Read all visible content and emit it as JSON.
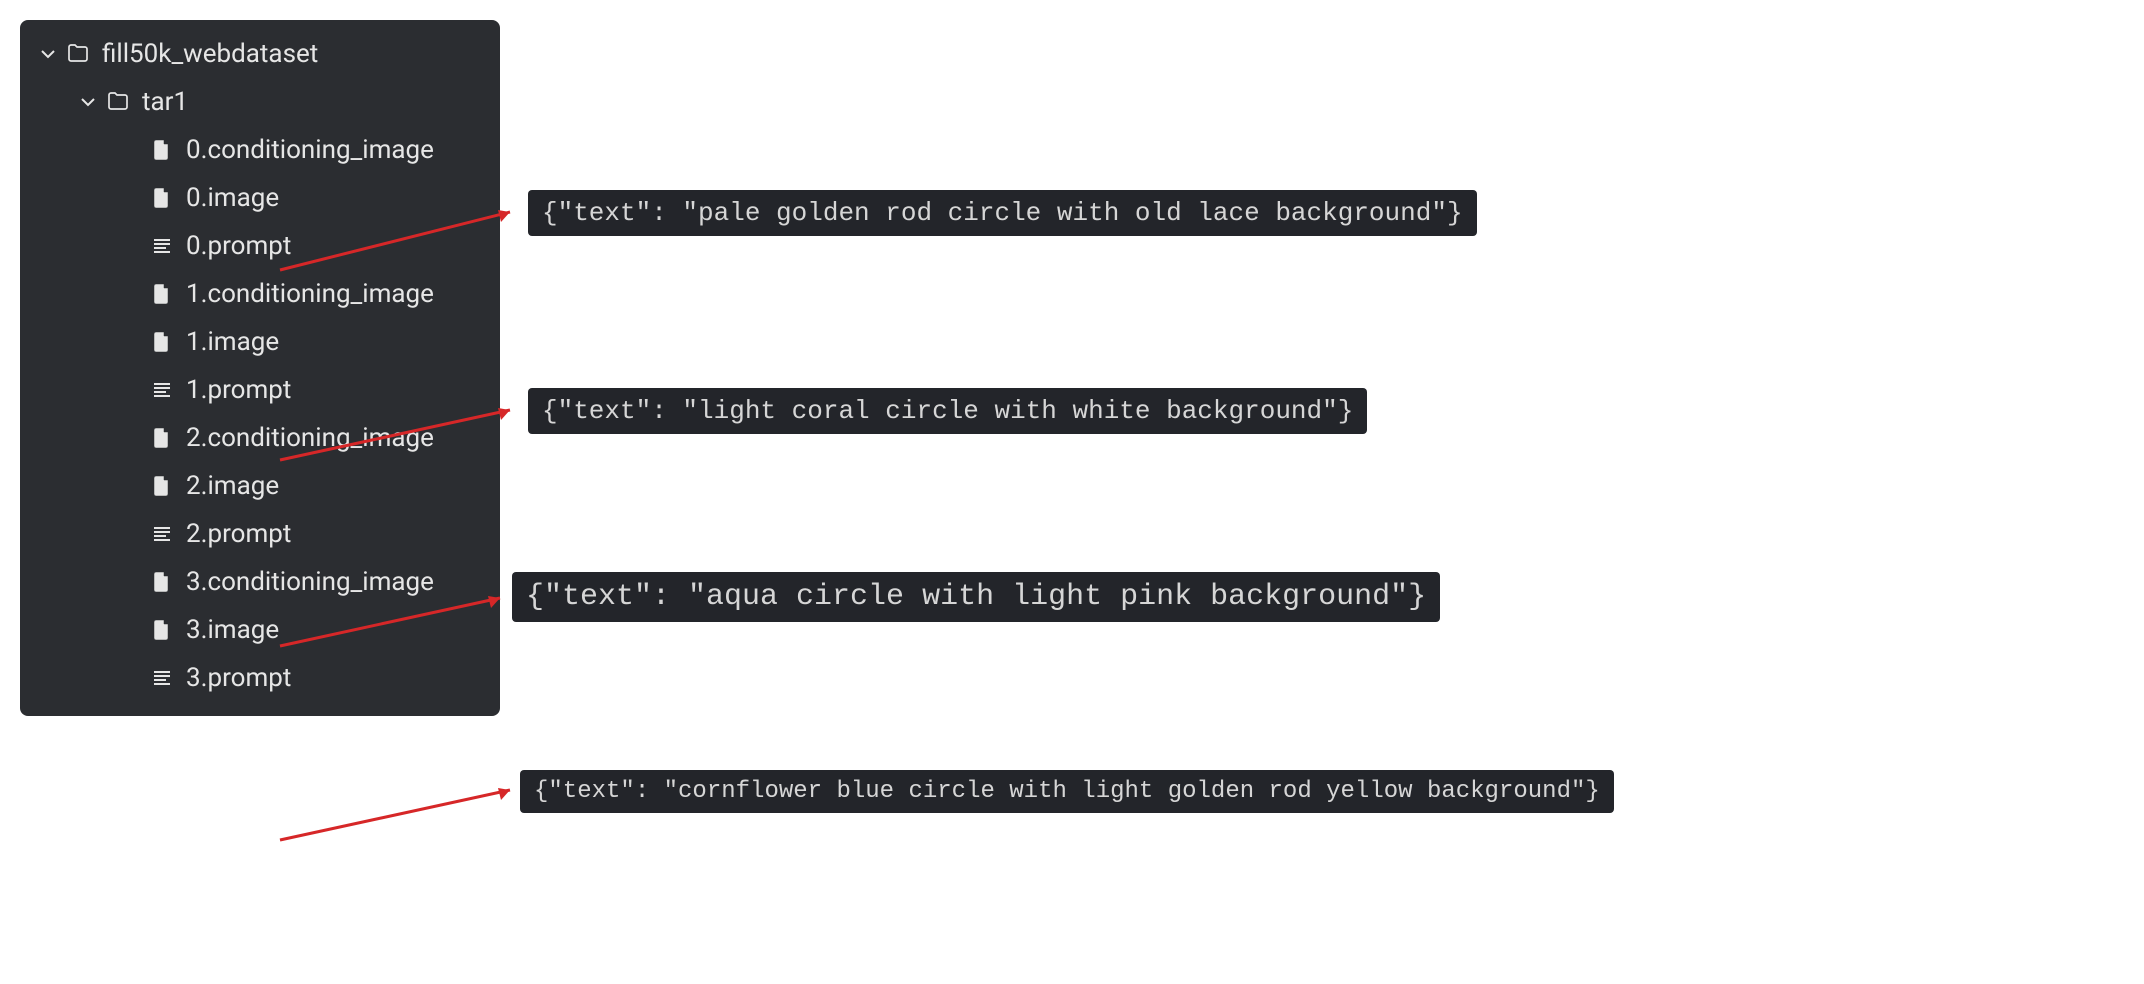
{
  "tree": {
    "root": {
      "label": "fill50k_webdataset",
      "children": {
        "tar1": {
          "label": "tar1",
          "files": [
            {
              "name": "0.conditioning_image",
              "type": "file"
            },
            {
              "name": "0.image",
              "type": "file"
            },
            {
              "name": "0.prompt",
              "type": "text"
            },
            {
              "name": "1.conditioning_image",
              "type": "file"
            },
            {
              "name": "1.image",
              "type": "file"
            },
            {
              "name": "1.prompt",
              "type": "text"
            },
            {
              "name": "2.conditioning_image",
              "type": "file"
            },
            {
              "name": "2.image",
              "type": "file"
            },
            {
              "name": "2.prompt",
              "type": "text"
            },
            {
              "name": "3.conditioning_image",
              "type": "file"
            },
            {
              "name": "3.image",
              "type": "file"
            },
            {
              "name": "3.prompt",
              "type": "text"
            }
          ]
        }
      }
    }
  },
  "previews": [
    {
      "content": "{\"text\": \"pale golden rod circle with old lace background\"}"
    },
    {
      "content": "{\"text\": \"light coral circle with white background\"}"
    },
    {
      "content": "{\"text\": \"aqua circle with light pink background\"}"
    },
    {
      "content": "{\"text\": \"cornflower blue circle with light golden rod yellow background\"}"
    }
  ]
}
